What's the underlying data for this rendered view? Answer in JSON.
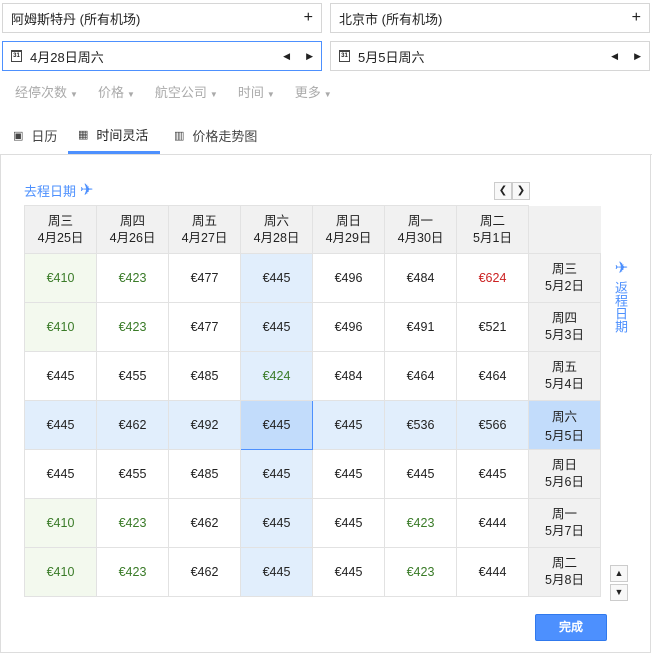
{
  "search": {
    "origin": "阿姆斯特丹 (所有机场)",
    "destination": "北京市 (所有机场)",
    "depart_date": "4月28日周六",
    "return_date": "5月5日周六",
    "add_symbol": "+",
    "prev_symbol": "◀",
    "next_symbol": "▶",
    "calendar_day": "31"
  },
  "filters": [
    {
      "label": "经停次数"
    },
    {
      "label": "价格"
    },
    {
      "label": "航空公司"
    },
    {
      "label": "时间"
    },
    {
      "label": "更多"
    }
  ],
  "tabs": [
    {
      "label": "日历",
      "icon": "calendar-icon"
    },
    {
      "label": "时间灵活",
      "icon": "grid-icon",
      "selected": true
    },
    {
      "label": "价格走势图",
      "icon": "bar-chart-icon"
    }
  ],
  "grid": {
    "depart_label": "去程日期",
    "return_label": "返程日期",
    "columns": [
      {
        "day": "周三",
        "date": "4月25日"
      },
      {
        "day": "周四",
        "date": "4月26日"
      },
      {
        "day": "周五",
        "date": "4月27日"
      },
      {
        "day": "周六",
        "date": "4月28日"
      },
      {
        "day": "周日",
        "date": "4月29日"
      },
      {
        "day": "周一",
        "date": "4月30日"
      },
      {
        "day": "周二",
        "date": "5月1日"
      }
    ],
    "rows": [
      {
        "day": "周三",
        "date": "5月2日",
        "prices": [
          "€410",
          "€423",
          "€477",
          "€445",
          "€496",
          "€484",
          "€624"
        ]
      },
      {
        "day": "周四",
        "date": "5月3日",
        "prices": [
          "€410",
          "€423",
          "€477",
          "€445",
          "€496",
          "€491",
          "€521"
        ]
      },
      {
        "day": "周五",
        "date": "5月4日",
        "prices": [
          "€445",
          "€455",
          "€485",
          "€424",
          "€484",
          "€464",
          "€464"
        ]
      },
      {
        "day": "周六",
        "date": "5月5日",
        "prices": [
          "€445",
          "€462",
          "€492",
          "€445",
          "€445",
          "€536",
          "€566"
        ]
      },
      {
        "day": "周日",
        "date": "5月6日",
        "prices": [
          "€445",
          "€455",
          "€485",
          "€445",
          "€445",
          "€445",
          "€445"
        ]
      },
      {
        "day": "周一",
        "date": "5月7日",
        "prices": [
          "€410",
          "€423",
          "€462",
          "€445",
          "€445",
          "€423",
          "€444"
        ]
      },
      {
        "day": "周二",
        "date": "5月8日",
        "prices": [
          "€410",
          "€423",
          "€462",
          "€445",
          "€445",
          "€423",
          "€444"
        ]
      }
    ],
    "low_cells": [
      "0-0",
      "0-1",
      "1-0",
      "1-1",
      "2-3",
      "5-0",
      "5-1",
      "5-5",
      "6-0",
      "6-1",
      "6-5"
    ],
    "high_cells": [
      "0-6"
    ],
    "selected_col": 3,
    "selected_row": 3,
    "colors": {
      "low": "#3a7b28",
      "high": "#cc2222",
      "accent": "#4d90fe"
    }
  },
  "done_label": "完成"
}
